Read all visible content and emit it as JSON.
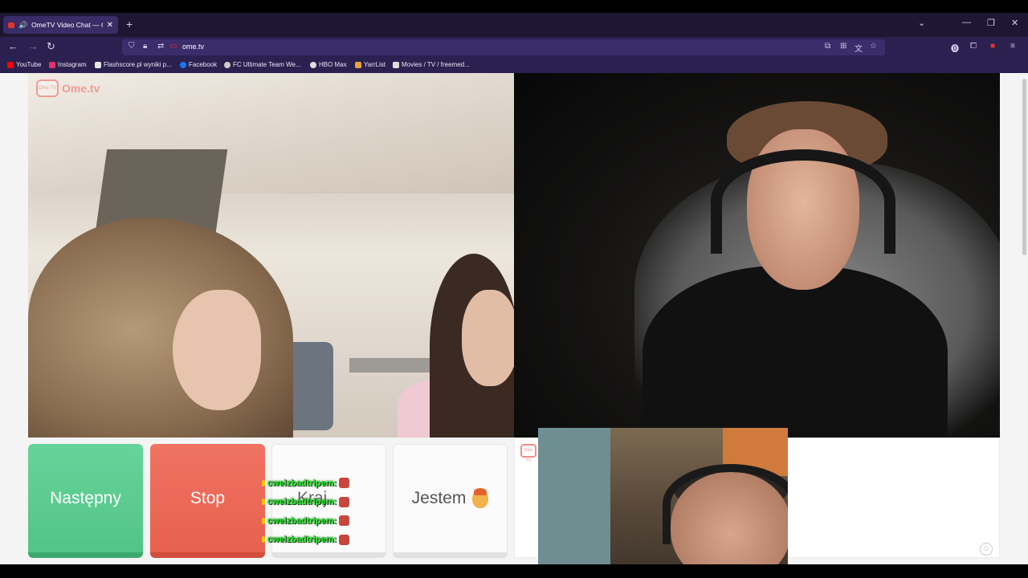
{
  "browser": {
    "tab_title": "OmeTV Video Chat — Ome",
    "url": "ome.tv",
    "bookmarks": [
      {
        "label": "YouTube",
        "icon": "youtube-icon",
        "color": "#ff0000"
      },
      {
        "label": "Instagram",
        "icon": "instagram-icon",
        "color": "#e1306c"
      },
      {
        "label": "Flashscore.pl wyniki p...",
        "icon": "flashscore-icon",
        "color": "#e8e8e8"
      },
      {
        "label": "Facebook",
        "icon": "facebook-icon",
        "color": "#1877f2"
      },
      {
        "label": "FC Ultimate Team We...",
        "icon": "globe-icon",
        "color": "#cccccc"
      },
      {
        "label": "HBO Max",
        "icon": "hbomax-icon",
        "color": "#dddddd"
      },
      {
        "label": "YarrList",
        "icon": "yarrlist-icon",
        "color": "#e6a23c"
      },
      {
        "label": "Movies / TV / freemed...",
        "icon": "play-icon",
        "color": "#dddddd"
      }
    ]
  },
  "site": {
    "logo_text": "Ome.tv",
    "logo_badge": "Ome TV"
  },
  "controls": {
    "next_label": "Następny",
    "stop_label": "Stop",
    "country_label": "Kraj",
    "gender_label": "Jestem"
  },
  "stream_chat": {
    "messages": [
      {
        "user": "cwelzbadtripem:"
      },
      {
        "user": "cwelzbadtripem:"
      },
      {
        "user": "cwelzbadtripem:"
      },
      {
        "user": "cwelzbadtripem:"
      }
    ]
  }
}
